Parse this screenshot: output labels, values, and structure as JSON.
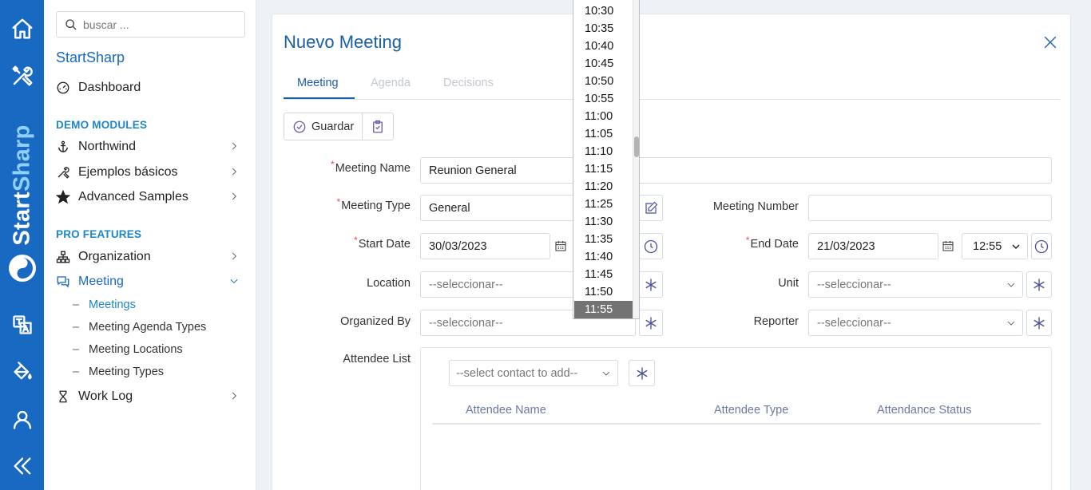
{
  "rail": {
    "brand_part1": "Start",
    "brand_part2": "Sharp"
  },
  "sidebar": {
    "search_placeholder": "buscar ...",
    "app_title": "StartSharp",
    "dashboard": "Dashboard",
    "section_demo": "DEMO MODULES",
    "northwind": "Northwind",
    "ejemplos": "Ejemplos básicos",
    "advanced": "Advanced Samples",
    "section_pro": "PRO FEATURES",
    "organization": "Organization",
    "meeting": "Meeting",
    "sub_items": [
      "Meetings",
      "Meeting Agenda Types",
      "Meeting Locations",
      "Meeting Types"
    ],
    "worklog": "Work Log"
  },
  "dialog": {
    "title": "Nuevo Meeting",
    "tabs": [
      "Meeting",
      "Agenda",
      "Decisions"
    ],
    "save_label": "Guardar",
    "fields": {
      "meeting_name_label": "Meeting Name",
      "meeting_name_value": "Reunion General",
      "meeting_type_label": "Meeting Type",
      "meeting_type_value": "General",
      "meeting_number_label": "Meeting Number",
      "meeting_number_value": "",
      "start_date_label": "Start Date",
      "start_date_value": "30/03/2023",
      "end_date_label": "End Date",
      "end_date_value": "21/03/2023",
      "end_time_value": "12:55",
      "location_label": "Location",
      "location_value": "--seleccionar--",
      "unit_label": "Unit",
      "unit_value": "--seleccionar--",
      "organized_by_label": "Organized By",
      "organized_by_value": "--seleccionar--",
      "reporter_label": "Reporter",
      "reporter_value": "--seleccionar--",
      "attendee_list_label": "Attendee List",
      "select_contact": "--select contact to add--"
    },
    "attendee_columns": [
      "Attendee Name",
      "Attendee Type",
      "Attendance Status"
    ]
  },
  "time_dropdown": {
    "options": [
      "10:30",
      "10:35",
      "10:40",
      "10:45",
      "10:50",
      "10:55",
      "11:00",
      "11:05",
      "11:10",
      "11:15",
      "11:20",
      "11:25",
      "11:30",
      "11:35",
      "11:40",
      "11:45",
      "11:50",
      "11:55"
    ],
    "selected": "11:55"
  },
  "colors": {
    "rail": "#1769c2",
    "accent": "#1a5ea8",
    "section": "#1d86c8",
    "required": "#d9534f"
  }
}
